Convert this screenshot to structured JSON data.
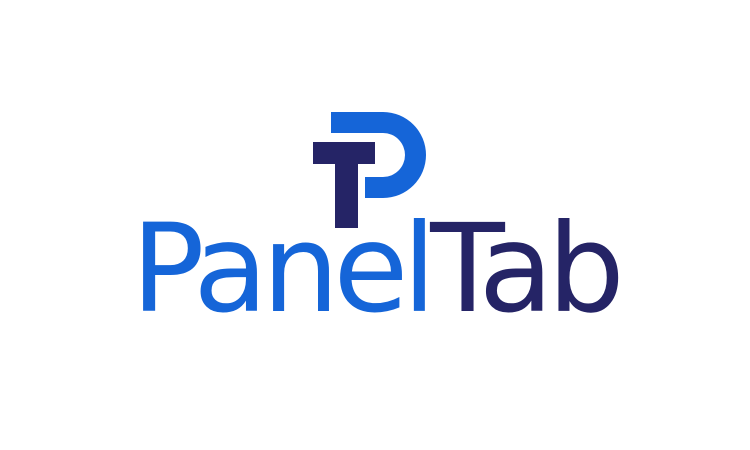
{
  "brand": {
    "name_part_1": "Panel",
    "name_part_2": "Tab",
    "colors": {
      "primary_blue": "#1565d8",
      "navy": "#252466",
      "background": "#ffffff"
    }
  }
}
